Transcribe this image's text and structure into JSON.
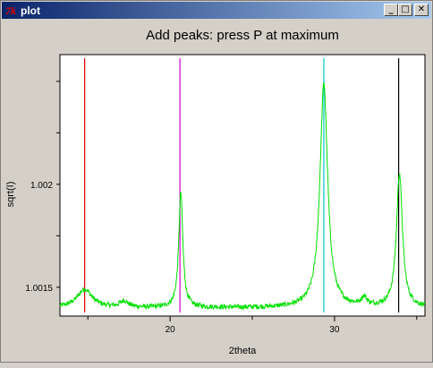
{
  "window": {
    "title": "plot",
    "app_icon_text": "7k",
    "buttons": {
      "minimize": "_",
      "maximize": "□",
      "close": "✕"
    }
  },
  "chart_data": {
    "type": "line",
    "title": "Add peaks: press P at maximum",
    "xlabel": "2theta",
    "ylabel": "sqrt(I)",
    "xlim": [
      13.3,
      35.5
    ],
    "ylim": [
      1.00136,
      1.00263
    ],
    "x_ticks": [
      20,
      30
    ],
    "y_ticks": [
      1.0015,
      1.002
    ],
    "series": [
      {
        "color": "#00e000",
        "baseline": 1.0014,
        "noise": 1.2e-05,
        "peaks": [
          {
            "x": 14.8,
            "height": 9e-05,
            "width": 0.55
          },
          {
            "x": 17.2,
            "height": 3e-05,
            "width": 0.3
          },
          {
            "x": 20.65,
            "height": 0.00056,
            "width": 0.15
          },
          {
            "x": 29.35,
            "height": 0.00109,
            "width": 0.28
          },
          {
            "x": 31.8,
            "height": 4e-05,
            "width": 0.2
          },
          {
            "x": 33.95,
            "height": 0.00065,
            "width": 0.22
          }
        ]
      }
    ],
    "markers": [
      {
        "x": 14.8,
        "color": "#e00000"
      },
      {
        "x": 20.6,
        "color": "#d000d0"
      },
      {
        "x": 29.35,
        "color": "#00c8c8"
      },
      {
        "x": 33.9,
        "color": "#000000"
      }
    ]
  }
}
